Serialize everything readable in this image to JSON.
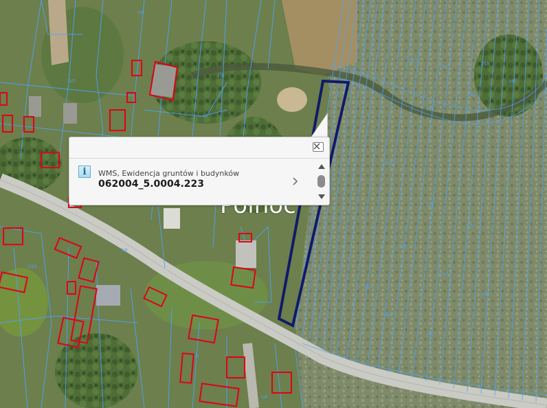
{
  "map": {
    "place_label": "Północ",
    "colors": {
      "parcel_lines": "#4da3ff",
      "building_outline": "#e0001a",
      "selected_parcel": "#111a6b",
      "road": "#c9cbc4"
    }
  },
  "popup": {
    "icon": "info-icon",
    "icon_glyph": "i",
    "layer_name": "WMS, Ewidencja gruntów i budynków",
    "feature_id": "062004_5.0004.223",
    "close_icon": "close-icon",
    "more_icon": "chevron-right-icon"
  }
}
